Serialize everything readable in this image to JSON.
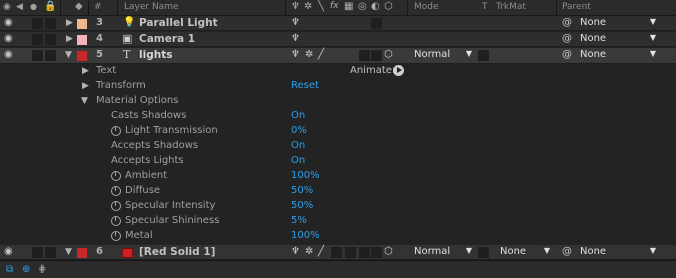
{
  "header": {
    "col_layer_name": "Layer Name",
    "col_num": "#",
    "col_mode": "Mode",
    "col_t": "T",
    "col_trkmat": "TrkMat",
    "col_parent": "Parent"
  },
  "layers": [
    {
      "num": "3",
      "name": "Parallel Light",
      "type_icon": "lightbulb-icon",
      "label_color": "#f0b78f",
      "parent": "None"
    },
    {
      "num": "4",
      "name": "Camera 1",
      "type_icon": "camera-icon",
      "label_color": "#f2b3bb",
      "parent": "None"
    },
    {
      "num": "5",
      "name": "lights",
      "type_icon": "text-layer-icon",
      "label_color": "#c8282a",
      "mode": "Normal",
      "parent": "None"
    },
    {
      "num": "6",
      "name": "[Red Solid 1]",
      "type_icon": "solid-icon",
      "label_color": "#c8282a",
      "mode": "Normal",
      "trkmat": "None",
      "parent": "None"
    }
  ],
  "props": {
    "text": "Text",
    "animate": "Animate:",
    "transform": "Transform",
    "transform_value": "Reset",
    "material_options": "Material Options",
    "rows": [
      {
        "label": "Casts Shadows",
        "value": "On",
        "stopwatch": false
      },
      {
        "label": "Light Transmission",
        "value": "0%",
        "stopwatch": true
      },
      {
        "label": "Accepts Shadows",
        "value": "On",
        "stopwatch": false
      },
      {
        "label": "Accepts Lights",
        "value": "On",
        "stopwatch": false
      },
      {
        "label": "Ambient",
        "value": "100%",
        "stopwatch": true
      },
      {
        "label": "Diffuse",
        "value": "50%",
        "stopwatch": true
      },
      {
        "label": "Specular Intensity",
        "value": "50%",
        "stopwatch": true
      },
      {
        "label": "Specular Shininess",
        "value": "5%",
        "stopwatch": true
      },
      {
        "label": "Metal",
        "value": "100%",
        "stopwatch": true
      }
    ]
  },
  "colors": {
    "accent": "#2d9fe8",
    "panel_bg": "#232323",
    "selected_row": "#3a3a3a"
  }
}
